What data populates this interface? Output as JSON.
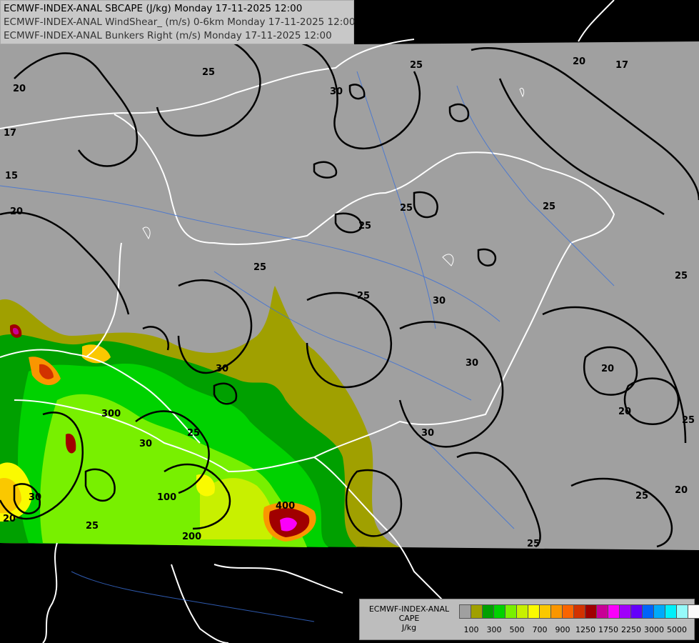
{
  "titles": [
    "ECMWF-INDEX-ANAL SBCAPE (J/kg) Monday 17-11-2025 12:00",
    "ECMWF-INDEX-ANAL WindShear_ (m/s) 0-6km Monday 17-11-2025 12:00",
    "ECMWF-INDEX-ANAL Bunkers Right (m/s) Monday 17-11-2025 12:00"
  ],
  "legend": {
    "line1": "ECMWF-INDEX-ANAL",
    "line2": "CAPE",
    "line3": "J/kg",
    "colors": [
      "#a0a0a0",
      "#a0a000",
      "#00a000",
      "#00d200",
      "#78f000",
      "#c8f000",
      "#fafa00",
      "#fac800",
      "#fa9600",
      "#fa6400",
      "#d23200",
      "#a00000",
      "#c80096",
      "#fa00fa",
      "#a000fa",
      "#6400fa",
      "#0064fa",
      "#00aafa",
      "#00f0fa",
      "#96fafa",
      "#fafafa"
    ],
    "ticks": [
      "100",
      "300",
      "500",
      "700",
      "900",
      "1250",
      "1750",
      "2250",
      "3000",
      "5000"
    ]
  },
  "contour_labels": [
    "25",
    "20",
    "30",
    "17",
    "15",
    "25",
    "20",
    "17",
    "25",
    "30",
    "25",
    "25",
    "25",
    "20",
    "30",
    "25",
    "20",
    "20",
    "25",
    "25",
    "20",
    "30",
    "25",
    "30",
    "300",
    "100",
    "400",
    "200",
    "30",
    "25",
    "25",
    "30",
    "20",
    "25"
  ]
}
